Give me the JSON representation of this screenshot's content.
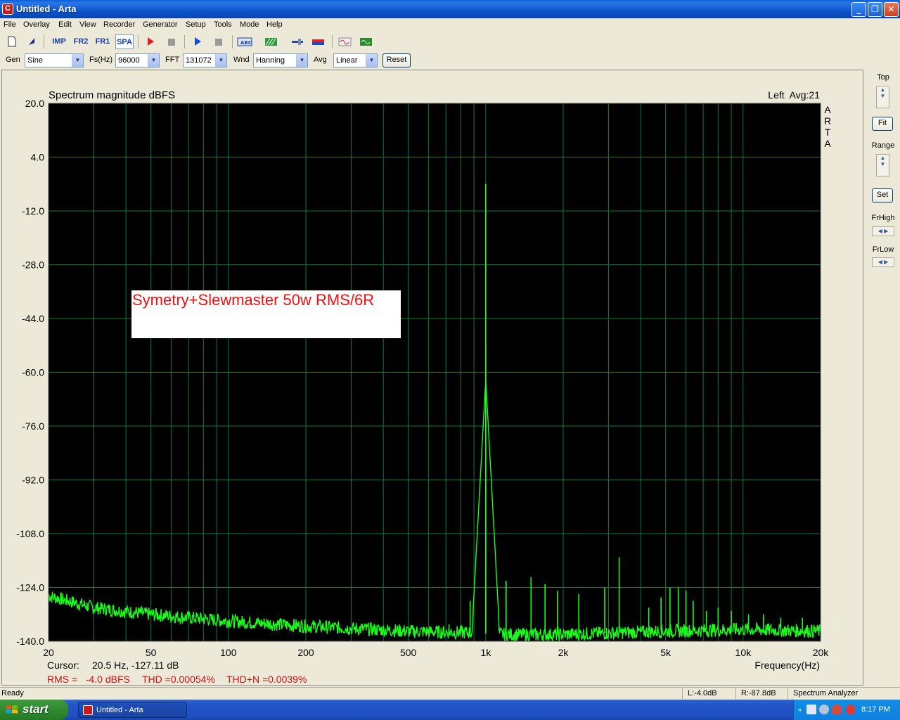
{
  "window": {
    "title": "Untitled - Arta"
  },
  "menu": [
    "File",
    "Overlay",
    "Edit",
    "View",
    "Recorder",
    "Generator",
    "Setup",
    "Tools",
    "Mode",
    "Help"
  ],
  "toolbar": {
    "imp": "IMP",
    "fr2": "FR2",
    "fr1": "FR1",
    "spa": "SPA"
  },
  "controls": {
    "gen_label": "Gen",
    "gen_value": "Sine",
    "fs_label": "Fs(Hz)",
    "fs_value": "96000",
    "fft_label": "FFT",
    "fft_value": "131072",
    "wnd_label": "Wnd",
    "wnd_value": "Hanning",
    "avg_label": "Avg",
    "avg_value": "Linear",
    "reset": "Reset"
  },
  "plot": {
    "title": "Spectrum magnitude dBFS",
    "channel_info": "Left  Avg:21",
    "brand": [
      "A",
      "R",
      "T",
      "A"
    ],
    "annotation": "Symetry+Slewmaster 50w RMS/6R",
    "cursor_label": "Cursor:",
    "cursor_value": "20.5 Hz, -127.11 dB",
    "measure_rms": "RMS =   -4.0 dBFS",
    "measure_thd": "THD =0.00054%",
    "measure_thdn": "THD+N =0.0039%"
  },
  "right_panel": {
    "top": "Top",
    "fit": "Fit",
    "range": "Range",
    "set": "Set",
    "frhigh": "FrHigh",
    "frlow": "FrLow"
  },
  "status": {
    "ready": "Ready",
    "left": "L:-4.0dB",
    "right": "R:-87.8dB",
    "mode": "Spectrum Analyzer"
  },
  "taskbar": {
    "start": "start",
    "task": "Untitled - Arta",
    "clock": "8:17 PM"
  },
  "colors": {
    "plot_bg": "#000000",
    "grid": "#0b7a3a",
    "trace": "#19ff19",
    "annotation": "#ee1111",
    "measure": "#cc1111"
  },
  "chart_data": {
    "type": "line",
    "title": "Spectrum magnitude dBFS",
    "xlabel": "Frequency(Hz)",
    "ylabel": "",
    "xscale": "log",
    "xlim": [
      20,
      20000
    ],
    "ylim": [
      -140,
      20
    ],
    "x_ticks": [
      20,
      50,
      100,
      200,
      500,
      1000,
      2000,
      5000,
      10000,
      20000
    ],
    "x_tick_labels": [
      "20",
      "50",
      "100",
      "200",
      "500",
      "1k",
      "2k",
      "5k",
      "10k",
      "20k"
    ],
    "y_ticks": [
      20,
      4,
      -12,
      -28,
      -44,
      -60,
      -76,
      -92,
      -108,
      -124,
      -140
    ],
    "y_tick_labels": [
      "20.0",
      "4.0",
      "-12.0",
      "-28.0",
      "-44.0",
      "-60.0",
      "-76.0",
      "-92.0",
      "-108.0",
      "-124.0",
      "-140.0"
    ],
    "grid": true,
    "noise_floor": [
      [
        20,
        -126.5
      ],
      [
        30,
        -130
      ],
      [
        50,
        -132
      ],
      [
        100,
        -134
      ],
      [
        200,
        -135.5
      ],
      [
        500,
        -137
      ],
      [
        900,
        -137.5
      ],
      [
        1200,
        -138
      ],
      [
        2000,
        -138
      ],
      [
        5000,
        -137
      ],
      [
        10000,
        -136.5
      ],
      [
        20000,
        -137
      ]
    ],
    "peaks": [
      {
        "x": 1000,
        "y": -4
      },
      {
        "x": 1000,
        "y": -52
      },
      {
        "x": 720,
        "y": -135
      },
      {
        "x": 870,
        "y": -128
      },
      {
        "x": 1200,
        "y": -122
      },
      {
        "x": 1500,
        "y": -121
      },
      {
        "x": 1700,
        "y": -123
      },
      {
        "x": 1900,
        "y": -125
      },
      {
        "x": 2300,
        "y": -126
      },
      {
        "x": 2900,
        "y": -124
      },
      {
        "x": 3300,
        "y": -115
      },
      {
        "x": 4300,
        "y": -130
      },
      {
        "x": 4800,
        "y": -127
      },
      {
        "x": 5200,
        "y": -124
      },
      {
        "x": 5600,
        "y": -124
      },
      {
        "x": 6000,
        "y": -125
      },
      {
        "x": 6400,
        "y": -128
      },
      {
        "x": 7200,
        "y": -131
      },
      {
        "x": 8000,
        "y": -130
      },
      {
        "x": 9000,
        "y": -131
      },
      {
        "x": 10500,
        "y": -132
      },
      {
        "x": 12000,
        "y": -132
      },
      {
        "x": 14000,
        "y": -133
      },
      {
        "x": 17000,
        "y": -133
      }
    ]
  }
}
